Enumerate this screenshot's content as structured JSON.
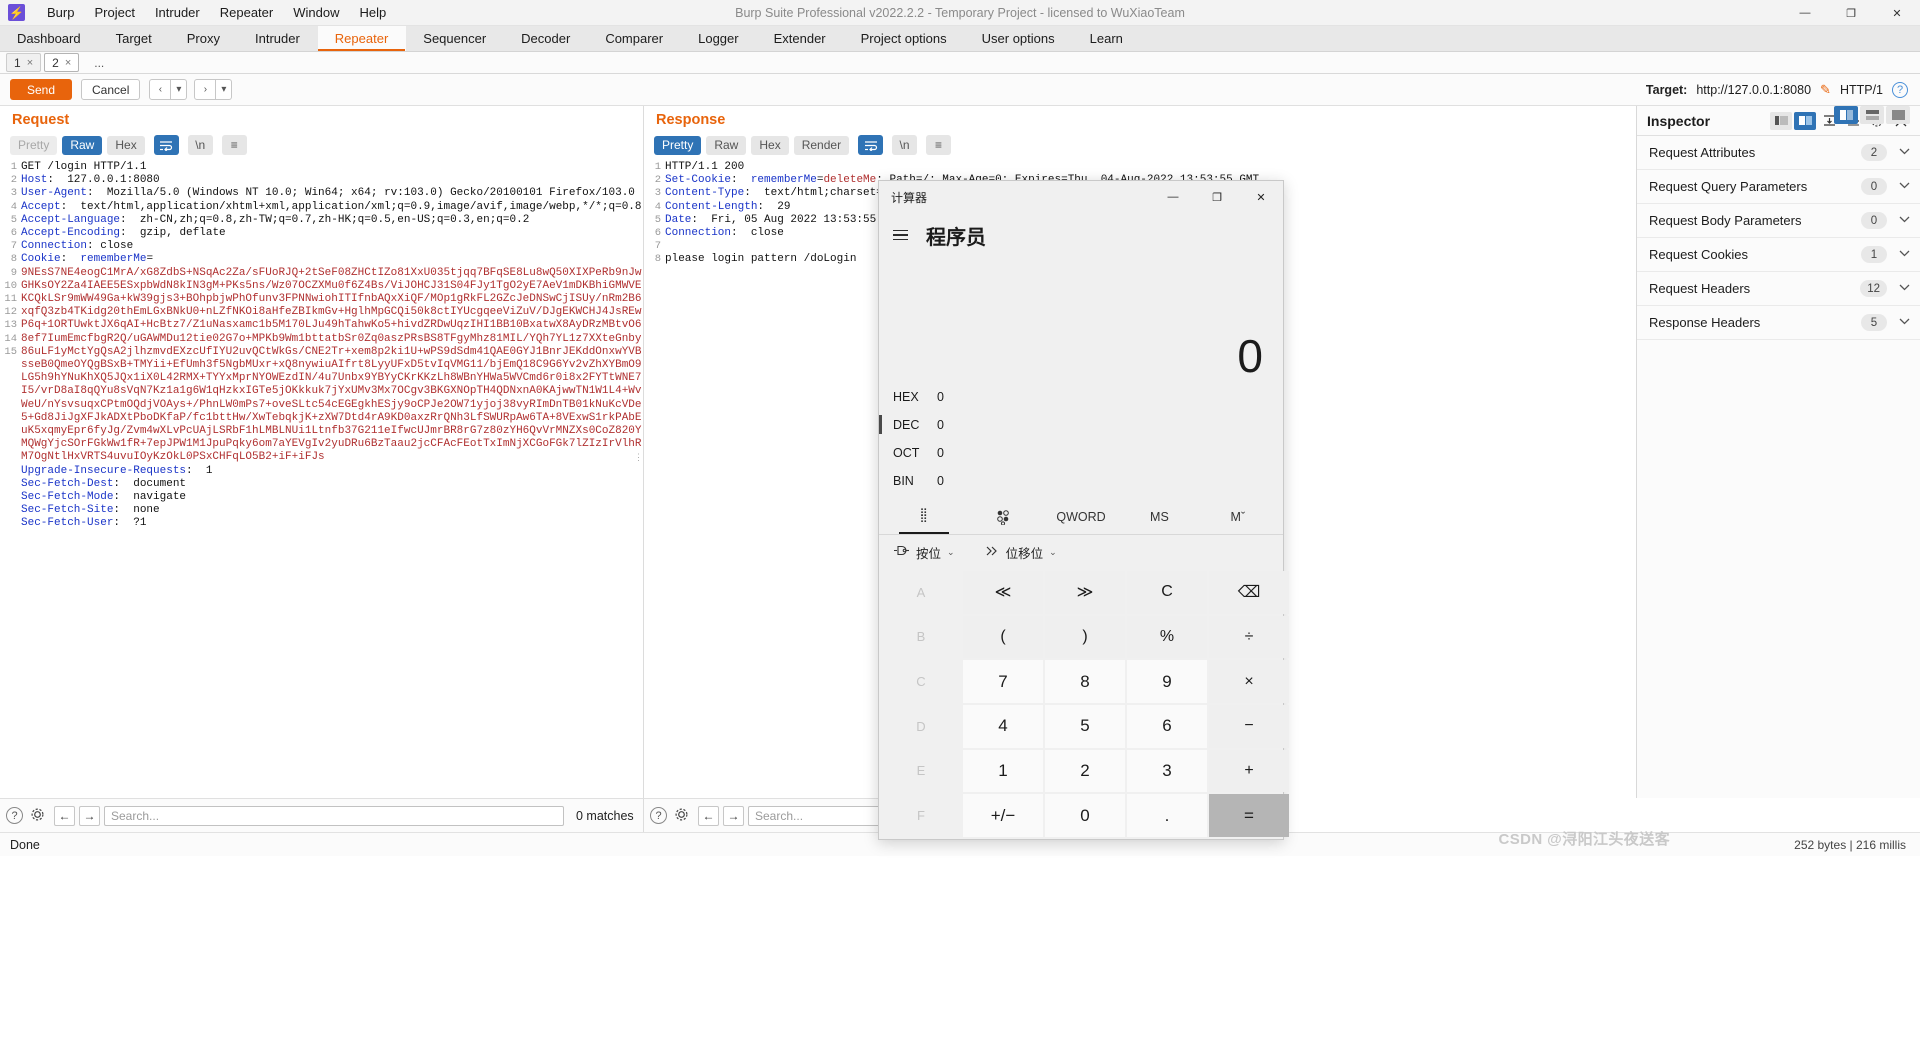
{
  "titlebar": {
    "logo_glyph": "⚡",
    "title": "Burp Suite Professional v2022.2.2 - Temporary Project - licensed to WuXiaoTeam",
    "menus": [
      "Burp",
      "Project",
      "Intruder",
      "Repeater",
      "Window",
      "Help"
    ],
    "window_buttons": [
      "—",
      "❐",
      "✕"
    ]
  },
  "main_tabs": [
    {
      "label": "Dashboard",
      "active": false
    },
    {
      "label": "Target",
      "active": false
    },
    {
      "label": "Proxy",
      "active": false
    },
    {
      "label": "Intruder",
      "active": false
    },
    {
      "label": "Repeater",
      "active": true
    },
    {
      "label": "Sequencer",
      "active": false
    },
    {
      "label": "Decoder",
      "active": false
    },
    {
      "label": "Comparer",
      "active": false
    },
    {
      "label": "Logger",
      "active": false
    },
    {
      "label": "Extender",
      "active": false
    },
    {
      "label": "Project options",
      "active": false
    },
    {
      "label": "User options",
      "active": false
    },
    {
      "label": "Learn",
      "active": false
    }
  ],
  "repeater_tabs": [
    {
      "label": "1",
      "close": "×",
      "active": false
    },
    {
      "label": "2",
      "close": "×",
      "active": true
    },
    {
      "label": "...",
      "close": "",
      "active": false
    }
  ],
  "actions": {
    "send_label": "Send",
    "cancel_label": "Cancel",
    "back_arrow": "‹",
    "back_caret": "▾",
    "fwd_arrow": "›",
    "fwd_caret": "▾",
    "target_label": "Target:",
    "target_url": "http://127.0.0.1:8080",
    "pencil_icon": "✎",
    "http_version": "HTTP/1",
    "help_icon": "?"
  },
  "request": {
    "title": "Request",
    "view_tabs": [
      "Pretty",
      "Raw",
      "Hex"
    ],
    "active_view": "Raw",
    "wrap_icon": "↩",
    "newline_label": "\\n",
    "menu_icon": "≡",
    "lines": [
      {
        "n": "1",
        "key": "",
        "text": "GET /login HTTP/1.1",
        "style": "plain"
      },
      {
        "n": "2",
        "key": "Host",
        "text": ":  127.0.0.1:8080",
        "style": "header"
      },
      {
        "n": "3",
        "key": "User-Agent",
        "text": ":  Mozilla/5.0 (Windows NT 10.0; Win64; x64; rv:103.0) Gecko/20100101 Firefox/103.0",
        "style": "header"
      },
      {
        "n": "4",
        "key": "Accept",
        "text": ":  text/html,application/xhtml+xml,application/xml;q=0.9,image/avif,image/webp,*/*;q=0.8",
        "style": "header"
      },
      {
        "n": "5",
        "key": "Accept-Language",
        "text": ":  zh-CN,zh;q=0.8,zh-TW;q=0.7,zh-HK;q=0.5,en-US;q=0.3,en;q=0.2",
        "style": "header"
      },
      {
        "n": "6",
        "key": "Accept-Encoding",
        "text": ":  gzip, deflate",
        "style": "header"
      },
      {
        "n": "7",
        "key": "Connection",
        "text": ": close",
        "style": "header"
      },
      {
        "n": "8",
        "key": "Cookie",
        "text": ":  rememberMe=",
        "style": "header"
      }
    ],
    "cookie_blob": "9NEsS7NE4eogC1MrA/xG8ZdbS+NSqAc2Za/sFUoRJQ+2tSeF08ZHCtIZo81XxU035tjqq7BFqSE8Lu8wQ50XIXPeRb9nJwGHKsOY2Za4IAEE5ESxpbWdN8kIN3gM+PKs5ns/Wz07OCZXMu0f6Z4Bs/ViJOHCJ31S04FJy1TgO2yE7AeV1mDKBhiGMWVEKCQkLSr9mWW49Ga+kW39gjs3+BOhpbjwPhOfunv3FPNNwiohITIfnbAQxXiQF/MOp1gRkFL2GZcJeDNSwCjISUy/nRm2B6xqfQ3zb4TKidg20thEmLGxBNkU0+nLZfNKOi8aHfeZBIkmGv+HglhMpGCQi50k8ctIYUcgqeeViZuV/DJgEKWCHJ4JsREwP6q+1ORTUwktJX6qAI+HcBtz7/Z1uNasxamc1b5M170LJu49hTahwKo5+hivdZRDwUqzIHI1BB10BxatwX8AyDRzMBtvO68ef7IumEmcfbgR2Q/uGAWMDu12tie02G7o+MPKb9Wm1bttatbSr0Zq0aszPRsBS8TFgyMhz81MIL/YQh7YL1z7XXteGnby86uLF1yMctYgQsA2jlhzmvdEXzcUfIYU2uvQCtWkGs/CNE2Tr+xem8p2ki1U+wPS9dSdm41QAE0GYJ1BnrJEKddOnxwYVBsseB0QmeOYQgBSxB+TMYii+EfUmh3f5NgbMUxr+xQ8nywiuAIfrt8LyyUFxD5tvIqVMG11/bjEmQ18C9G6Yv2vZhXYBmO9LG5h9hYNuKhXQ5JQx1iX0L42RMX+TYYxMprNYOWEzdIN/4u7Unbx9YBYyCKrKKzLh8WBnYHWa5WVCmd6r0i8x2FYTtWNE7I5/vrD8aI8qQYu8sVqN7Kz1a1g6W1qHzkxIGTe5jOKkkuk7jYxUMv3Mx7OCgv3BKGXNOpTH4QDNxnA0KAjwwTN1W1L4+WvWeU/nYsvsuqxCPtmOQdjVOAys+/PhnLW0mPs7+oveSLtc54cEGEgkhESjy9oCPJe2OW71yjoj38vyRImDnTB01kNuKcVDe5+Gd8JiJgXFJkADXtPboDKfaP/fc1bttHw/XwTebqkjK+zXW7Dtd4rA9KD0axzRrQNh3LfSWURpAw6TA+8VExwS1rkPAbEuK5xqmyEpr6fyJg/Zvm4wXLvPcUAjLSRbF1hLMBLNUi1Ltnfb37G211eIfwcUJmrBR8rG7z80zYH6QvVrMNZXs0CoZ820YMQWgYjcSOrFGkWw1fR+7epJPW1M1JpuPqky6om7aYEVgIv2yuDRu6BzTaau2jcCFAcFEotTxImNjXCGoFGk7lZIzIrVlhRM7OgNtlHxVRTS4uvuIOyKzOkL0PSxCHFqLO5B2+iF+iFJs",
    "tail_lines": [
      {
        "n": "9",
        "key": "Upgrade-Insecure-Requests",
        "text": ":  1"
      },
      {
        "n": "10",
        "key": "Sec-Fetch-Dest",
        "text": ":  document"
      },
      {
        "n": "11",
        "key": "Sec-Fetch-Mode",
        "text": ":  navigate"
      },
      {
        "n": "12",
        "key": "Sec-Fetch-Site",
        "text": ":  none"
      },
      {
        "n": "13",
        "key": "Sec-Fetch-User",
        "text": ":  ?1"
      },
      {
        "n": "14",
        "key": "",
        "text": ""
      },
      {
        "n": "15",
        "key": "",
        "text": ""
      }
    ],
    "search_placeholder": "Search...",
    "matches_label": "0 matches"
  },
  "response": {
    "title": "Response",
    "view_tabs": [
      "Pretty",
      "Raw",
      "Hex",
      "Render"
    ],
    "active_view": "Pretty",
    "wrap_icon": "↩",
    "newline_label": "\\n",
    "menu_icon": "≡",
    "lines": [
      {
        "n": "1",
        "key": "",
        "text": "HTTP/1.1 200",
        "style": "plain"
      },
      {
        "n": "2",
        "key": "Set-Cookie",
        "text": ":  rememberMe=deleteMe; Path=/; Max-Age=0; Expires=Thu, 04-Aug-2022 13:53:55 GMT",
        "style": "cookie"
      },
      {
        "n": "3",
        "key": "Content-Type",
        "text": ":  text/html;charset=UTF-8",
        "style": "header"
      },
      {
        "n": "4",
        "key": "Content-Length",
        "text": ":  29",
        "style": "header"
      },
      {
        "n": "5",
        "key": "Date",
        "text": ":  Fri, 05 Aug 2022 13:53:55 GMT",
        "style": "header"
      },
      {
        "n": "6",
        "key": "Connection",
        "text": ":  close",
        "style": "header"
      },
      {
        "n": "7",
        "key": "",
        "text": "",
        "style": "plain"
      },
      {
        "n": "8",
        "key": "",
        "text": "please login pattern /doLogin",
        "style": "plain"
      }
    ],
    "search_placeholder": "Search...",
    "view_layout_icons": [
      "split-vertical",
      "split-horizontal",
      "single-pane"
    ]
  },
  "inspector": {
    "title": "Inspector",
    "icons": [
      "layout-left",
      "layout-right",
      "expand-all",
      "collapse-all",
      "gear",
      "close"
    ],
    "rows": [
      {
        "label": "Request Attributes",
        "count": "2"
      },
      {
        "label": "Request Query Parameters",
        "count": "0"
      },
      {
        "label": "Request Body Parameters",
        "count": "0"
      },
      {
        "label": "Request Cookies",
        "count": "1"
      },
      {
        "label": "Request Headers",
        "count": "12"
      },
      {
        "label": "Response Headers",
        "count": "5"
      }
    ],
    "chevron": "⌄"
  },
  "statusbar": {
    "left": "Done",
    "right": "252 bytes | 216 millis",
    "watermark": "CSDN @浔阳江头夜送客"
  },
  "calculator": {
    "window_title": "计算器",
    "window_buttons": [
      "—",
      "❐",
      "✕"
    ],
    "menu_icon": "≡",
    "mode": "程序员",
    "display_value": "0",
    "radix": [
      {
        "name": "HEX",
        "value": "0",
        "active": false
      },
      {
        "name": "DEC",
        "value": "0",
        "active": true
      },
      {
        "name": "OCT",
        "value": "0",
        "active": false
      },
      {
        "name": "BIN",
        "value": "0",
        "active": false
      }
    ],
    "tabs": [
      {
        "label": "",
        "icon": "keypad-dots",
        "selected": true
      },
      {
        "label": "",
        "icon": "bit-toggle-dots",
        "selected": false
      },
      {
        "label": "QWORD",
        "icon": "",
        "selected": false
      },
      {
        "label": "MS",
        "icon": "",
        "selected": false
      },
      {
        "label": "Mˇ",
        "icon": "",
        "selected": false
      }
    ],
    "bit_controls": [
      {
        "icon": "logic-gate",
        "label": "按位",
        "caret": "⌄"
      },
      {
        "icon": "bitshift",
        "label": "位移位",
        "caret": "⌄"
      }
    ],
    "keys": [
      {
        "label": "A",
        "type": "hexdim"
      },
      {
        "label": "≪",
        "type": "op"
      },
      {
        "label": "≫",
        "type": "op"
      },
      {
        "label": "C",
        "type": "op"
      },
      {
        "label": "⌫",
        "type": "op"
      },
      {
        "label": "B",
        "type": "hexdim"
      },
      {
        "label": "(",
        "type": "op"
      },
      {
        "label": ")",
        "type": "op"
      },
      {
        "label": "%",
        "type": "op"
      },
      {
        "label": "÷",
        "type": "op"
      },
      {
        "label": "C",
        "type": "hexdim"
      },
      {
        "label": "7",
        "type": "num"
      },
      {
        "label": "8",
        "type": "num"
      },
      {
        "label": "9",
        "type": "num"
      },
      {
        "label": "×",
        "type": "op"
      },
      {
        "label": "D",
        "type": "hexdim"
      },
      {
        "label": "4",
        "type": "num"
      },
      {
        "label": "5",
        "type": "num"
      },
      {
        "label": "6",
        "type": "num"
      },
      {
        "label": "−",
        "type": "op"
      },
      {
        "label": "E",
        "type": "hexdim"
      },
      {
        "label": "1",
        "type": "num"
      },
      {
        "label": "2",
        "type": "num"
      },
      {
        "label": "3",
        "type": "num"
      },
      {
        "label": "+",
        "type": "op"
      },
      {
        "label": "F",
        "type": "hexdim"
      },
      {
        "label": "+/−",
        "type": "num"
      },
      {
        "label": "0",
        "type": "num"
      },
      {
        "label": ".",
        "type": "num"
      },
      {
        "label": "=",
        "type": "eq"
      }
    ]
  }
}
